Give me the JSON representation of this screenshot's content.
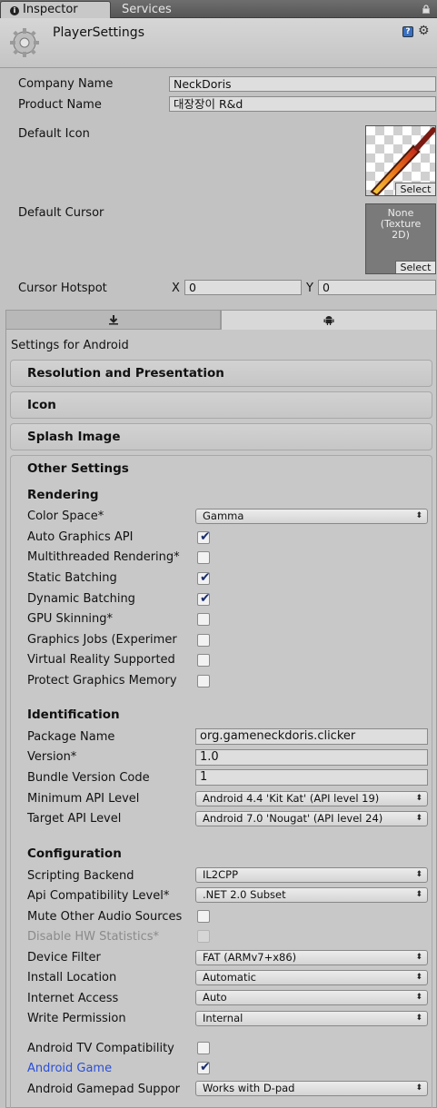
{
  "tabs": {
    "inspector": "Inspector",
    "services": "Services"
  },
  "header": {
    "title": "PlayerSettings"
  },
  "company_name": {
    "label": "Company Name",
    "value": "NeckDoris"
  },
  "product_name": {
    "label": "Product Name",
    "value": "대장장이 R&d"
  },
  "default_icon": {
    "label": "Default Icon",
    "select": "Select"
  },
  "default_cursor": {
    "label": "Default Cursor",
    "none_line1": "None",
    "none_line2": "(Texture",
    "none_line3": "2D)",
    "select": "Select"
  },
  "cursor_hotspot": {
    "label": "Cursor Hotspot",
    "x_label": "X",
    "x_value": "0",
    "y_label": "Y",
    "y_value": "0"
  },
  "platform": {
    "settings_for": "Settings for Android"
  },
  "sections": {
    "resolution": "Resolution and Presentation",
    "icon": "Icon",
    "splash": "Splash Image",
    "other": "Other Settings"
  },
  "rendering": {
    "heading": "Rendering",
    "color_space": {
      "label": "Color Space*",
      "value": "Gamma"
    },
    "auto_graphics_api": {
      "label": "Auto Graphics API",
      "checked": true
    },
    "multithreaded": {
      "label": "Multithreaded Rendering*",
      "checked": false
    },
    "static_batching": {
      "label": "Static Batching",
      "checked": true
    },
    "dynamic_batching": {
      "label": "Dynamic Batching",
      "checked": true
    },
    "gpu_skinning": {
      "label": "GPU Skinning*",
      "checked": false
    },
    "graphics_jobs": {
      "label": "Graphics Jobs (Experimer",
      "checked": false
    },
    "vr_supported": {
      "label": "Virtual Reality Supported",
      "checked": false
    },
    "protect_memory": {
      "label": "Protect Graphics Memory",
      "checked": false
    }
  },
  "identification": {
    "heading": "Identification",
    "package_name": {
      "label": "Package Name",
      "value": "org.gameneckdoris.clicker"
    },
    "version": {
      "label": "Version*",
      "value": "1.0"
    },
    "bundle_code": {
      "label": "Bundle Version Code",
      "value": "1"
    },
    "min_api": {
      "label": "Minimum API Level",
      "value": "Android 4.4 'Kit Kat' (API level 19)"
    },
    "target_api": {
      "label": "Target API Level",
      "value": "Android 7.0 'Nougat' (API level 24)"
    }
  },
  "configuration": {
    "heading": "Configuration",
    "scripting_backend": {
      "label": "Scripting Backend",
      "value": "IL2CPP"
    },
    "api_compat": {
      "label": "Api Compatibility Level*",
      "value": ".NET 2.0 Subset"
    },
    "mute_audio": {
      "label": "Mute Other Audio Sources",
      "checked": false
    },
    "disable_hw_stats": {
      "label": "Disable HW Statistics*",
      "checked": false
    },
    "device_filter": {
      "label": "Device Filter",
      "value": "FAT (ARMv7+x86)"
    },
    "install_location": {
      "label": "Install Location",
      "value": "Automatic"
    },
    "internet_access": {
      "label": "Internet Access",
      "value": "Auto"
    },
    "write_permission": {
      "label": "Write Permission",
      "value": "Internal"
    },
    "android_tv": {
      "label": "Android TV Compatibility",
      "checked": false
    },
    "android_game": {
      "label": "Android Game",
      "checked": true
    },
    "gamepad_support": {
      "label": "Android Gamepad Suppor",
      "value": "Works with D-pad"
    }
  },
  "colors": {
    "link_blue": "#2a4fd6",
    "check_blue": "#1a2c6c"
  }
}
